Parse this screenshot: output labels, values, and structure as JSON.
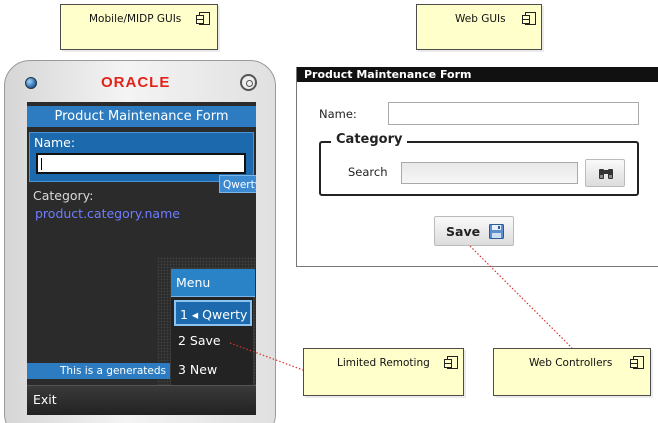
{
  "components": {
    "mobile_guis": "Mobile/MIDP GUIs",
    "web_guis": "Web GUIs",
    "limited_remoting": "Limited Remoting",
    "web_controllers": "Web Controllers"
  },
  "phone": {
    "brand": "ORACLE",
    "screen_title": "Product Maintenance Form",
    "name_label": "Name:",
    "name_value": "",
    "input_mode_tip": "Qwerty",
    "category_label": "Category:",
    "category_value": "product.category.name",
    "menu": {
      "title": "Menu",
      "items": [
        "1 ◂ Qwerty",
        "2   Save",
        "3   New"
      ]
    },
    "status_text": "This is a generateds",
    "softkey_left": "Exit"
  },
  "web_form": {
    "title": "Product Maintenance Form",
    "name_label": "Name:",
    "name_value": "",
    "category_legend": "Category",
    "search_label": "Search",
    "search_value": "",
    "save_label": "Save"
  },
  "colors": {
    "note_fill": "#ffffcc",
    "phone_accent": "#2d7cc1",
    "brand_red": "#e2231a",
    "connector_red": "#d9322f"
  },
  "icons": [
    "component-icon",
    "search-binoculars-icon",
    "floppy-disk-icon",
    "power-icon",
    "led-icon"
  ]
}
